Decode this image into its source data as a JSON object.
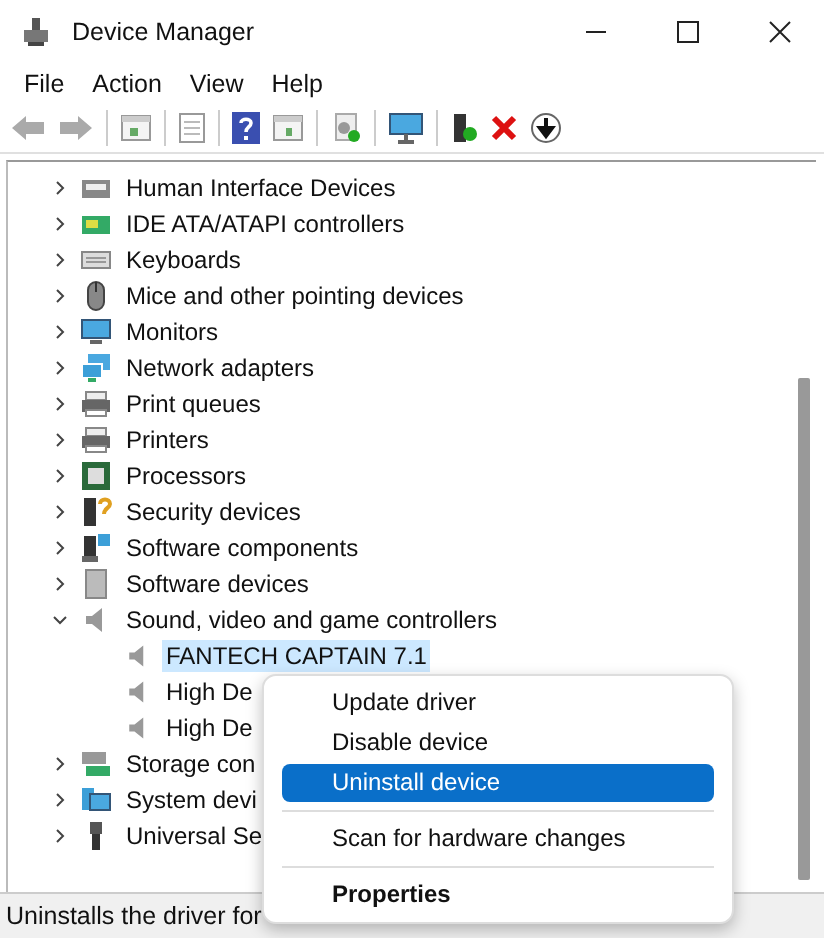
{
  "window": {
    "title": "Device Manager"
  },
  "menu": [
    "File",
    "Action",
    "View",
    "Help"
  ],
  "tree": [
    {
      "label": "Human Interface Devices",
      "expanded": false
    },
    {
      "label": "IDE ATA/ATAPI controllers",
      "expanded": false
    },
    {
      "label": "Keyboards",
      "expanded": false
    },
    {
      "label": "Mice and other pointing devices",
      "expanded": false
    },
    {
      "label": "Monitors",
      "expanded": false
    },
    {
      "label": "Network adapters",
      "expanded": false
    },
    {
      "label": "Print queues",
      "expanded": false
    },
    {
      "label": "Printers",
      "expanded": false
    },
    {
      "label": "Processors",
      "expanded": false
    },
    {
      "label": "Security devices",
      "expanded": false
    },
    {
      "label": "Software components",
      "expanded": false
    },
    {
      "label": "Software devices",
      "expanded": false
    },
    {
      "label": "Sound, video and game controllers",
      "expanded": true,
      "children": [
        {
          "label": "FANTECH CAPTAIN 7.1",
          "selected": true
        },
        {
          "label": "High De",
          "selected": false
        },
        {
          "label": "High De",
          "selected": false
        }
      ]
    },
    {
      "label": "Storage con",
      "expanded": false
    },
    {
      "label": "System devi",
      "expanded": false
    },
    {
      "label": "Universal Se",
      "expanded": false
    }
  ],
  "context_menu": [
    {
      "kind": "item",
      "label": "Update driver",
      "selected": false,
      "default": false
    },
    {
      "kind": "item",
      "label": "Disable device",
      "selected": false,
      "default": false
    },
    {
      "kind": "item",
      "label": "Uninstall device",
      "selected": true,
      "default": false
    },
    {
      "kind": "separator"
    },
    {
      "kind": "item",
      "label": "Scan for hardware changes",
      "selected": false,
      "default": false
    },
    {
      "kind": "separator"
    },
    {
      "kind": "item",
      "label": "Properties",
      "selected": false,
      "default": true
    }
  ],
  "status_bar": "Uninstalls the driver for"
}
